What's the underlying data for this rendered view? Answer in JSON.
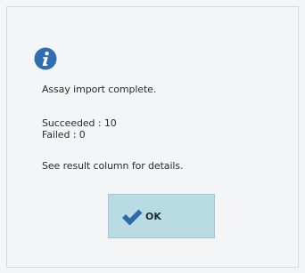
{
  "dialog": {
    "message": "Assay import complete.",
    "succeeded": "Succeeded : 10",
    "failed": "Failed : 0",
    "details": "See result column for details.",
    "ok_label": "OK",
    "icon": "info-icon",
    "accent": "#2f6fb0",
    "button_color": "#b9dbe3",
    "check_color": "#2c6aa8"
  }
}
